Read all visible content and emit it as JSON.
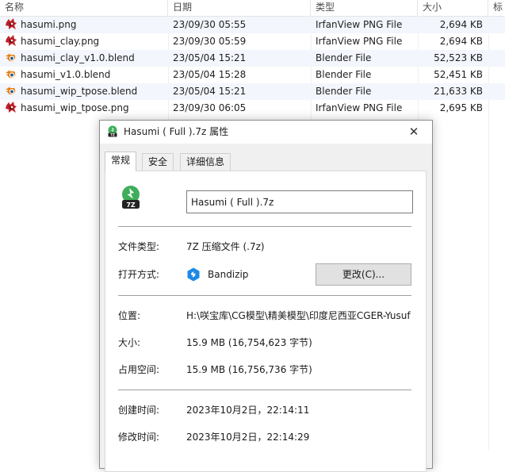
{
  "list": {
    "columns": [
      "名称",
      "日期",
      "类型",
      "大小",
      "标"
    ],
    "files": [
      {
        "name": "hasumi.png",
        "date": "23/09/30 05:55",
        "type": "IrfanView PNG File",
        "size": "2,694 KB",
        "icon": "irfanview-png-icon"
      },
      {
        "name": "hasumi_clay.png",
        "date": "23/09/30 05:59",
        "type": "IrfanView PNG File",
        "size": "2,694 KB",
        "icon": "irfanview-png-icon"
      },
      {
        "name": "hasumi_clay_v1.0.blend",
        "date": "23/05/04 15:21",
        "type": "Blender File",
        "size": "52,523 KB",
        "icon": "blender-icon"
      },
      {
        "name": "hasumi_v1.0.blend",
        "date": "23/05/04 15:28",
        "type": "Blender File",
        "size": "52,451 KB",
        "icon": "blender-icon"
      },
      {
        "name": "hasumi_wip_tpose.blend",
        "date": "23/05/04 15:21",
        "type": "Blender File",
        "size": "21,633 KB",
        "icon": "blender-icon"
      },
      {
        "name": "hasumi_wip_tpose.png",
        "date": "23/09/30 06:05",
        "type": "IrfanView PNG File",
        "size": "2,695 KB",
        "icon": "irfanview-png-icon"
      }
    ]
  },
  "dialog": {
    "title": "Hasumi ( Full ).7z 属性",
    "close_glyph": "✕",
    "tabs": [
      "常规",
      "安全",
      "详细信息"
    ],
    "filename": "Hasumi ( Full ).7z",
    "type_label": "文件类型:",
    "type_value": "7Z 压缩文件 (.7z)",
    "opens_label": "打开方式:",
    "opens_app": "Bandizip",
    "change_button": "更改(C)...",
    "location_label": "位置:",
    "location_value": "H:\\咲宝库\\CG模型\\精美模型\\印度尼西亚CGER-Yusuf",
    "size_label": "大小:",
    "size_value": "15.9 MB (16,754,623 字节)",
    "disk_label": "占用空间:",
    "disk_value": "15.9 MB (16,756,736 字节)",
    "created_label": "创建时间:",
    "created_value": "2023年10月2日，22:14:11",
    "modified_label": "修改时间:",
    "modified_value": "2023年10月2日，22:14:29"
  },
  "colors": {
    "stripe": "#f3f6fc",
    "sevenzip_green": "#3fae5a",
    "bandizip_blue": "#1e88e5",
    "blender_orange": "#e87d0d",
    "irfan_red": "#c0222a"
  }
}
